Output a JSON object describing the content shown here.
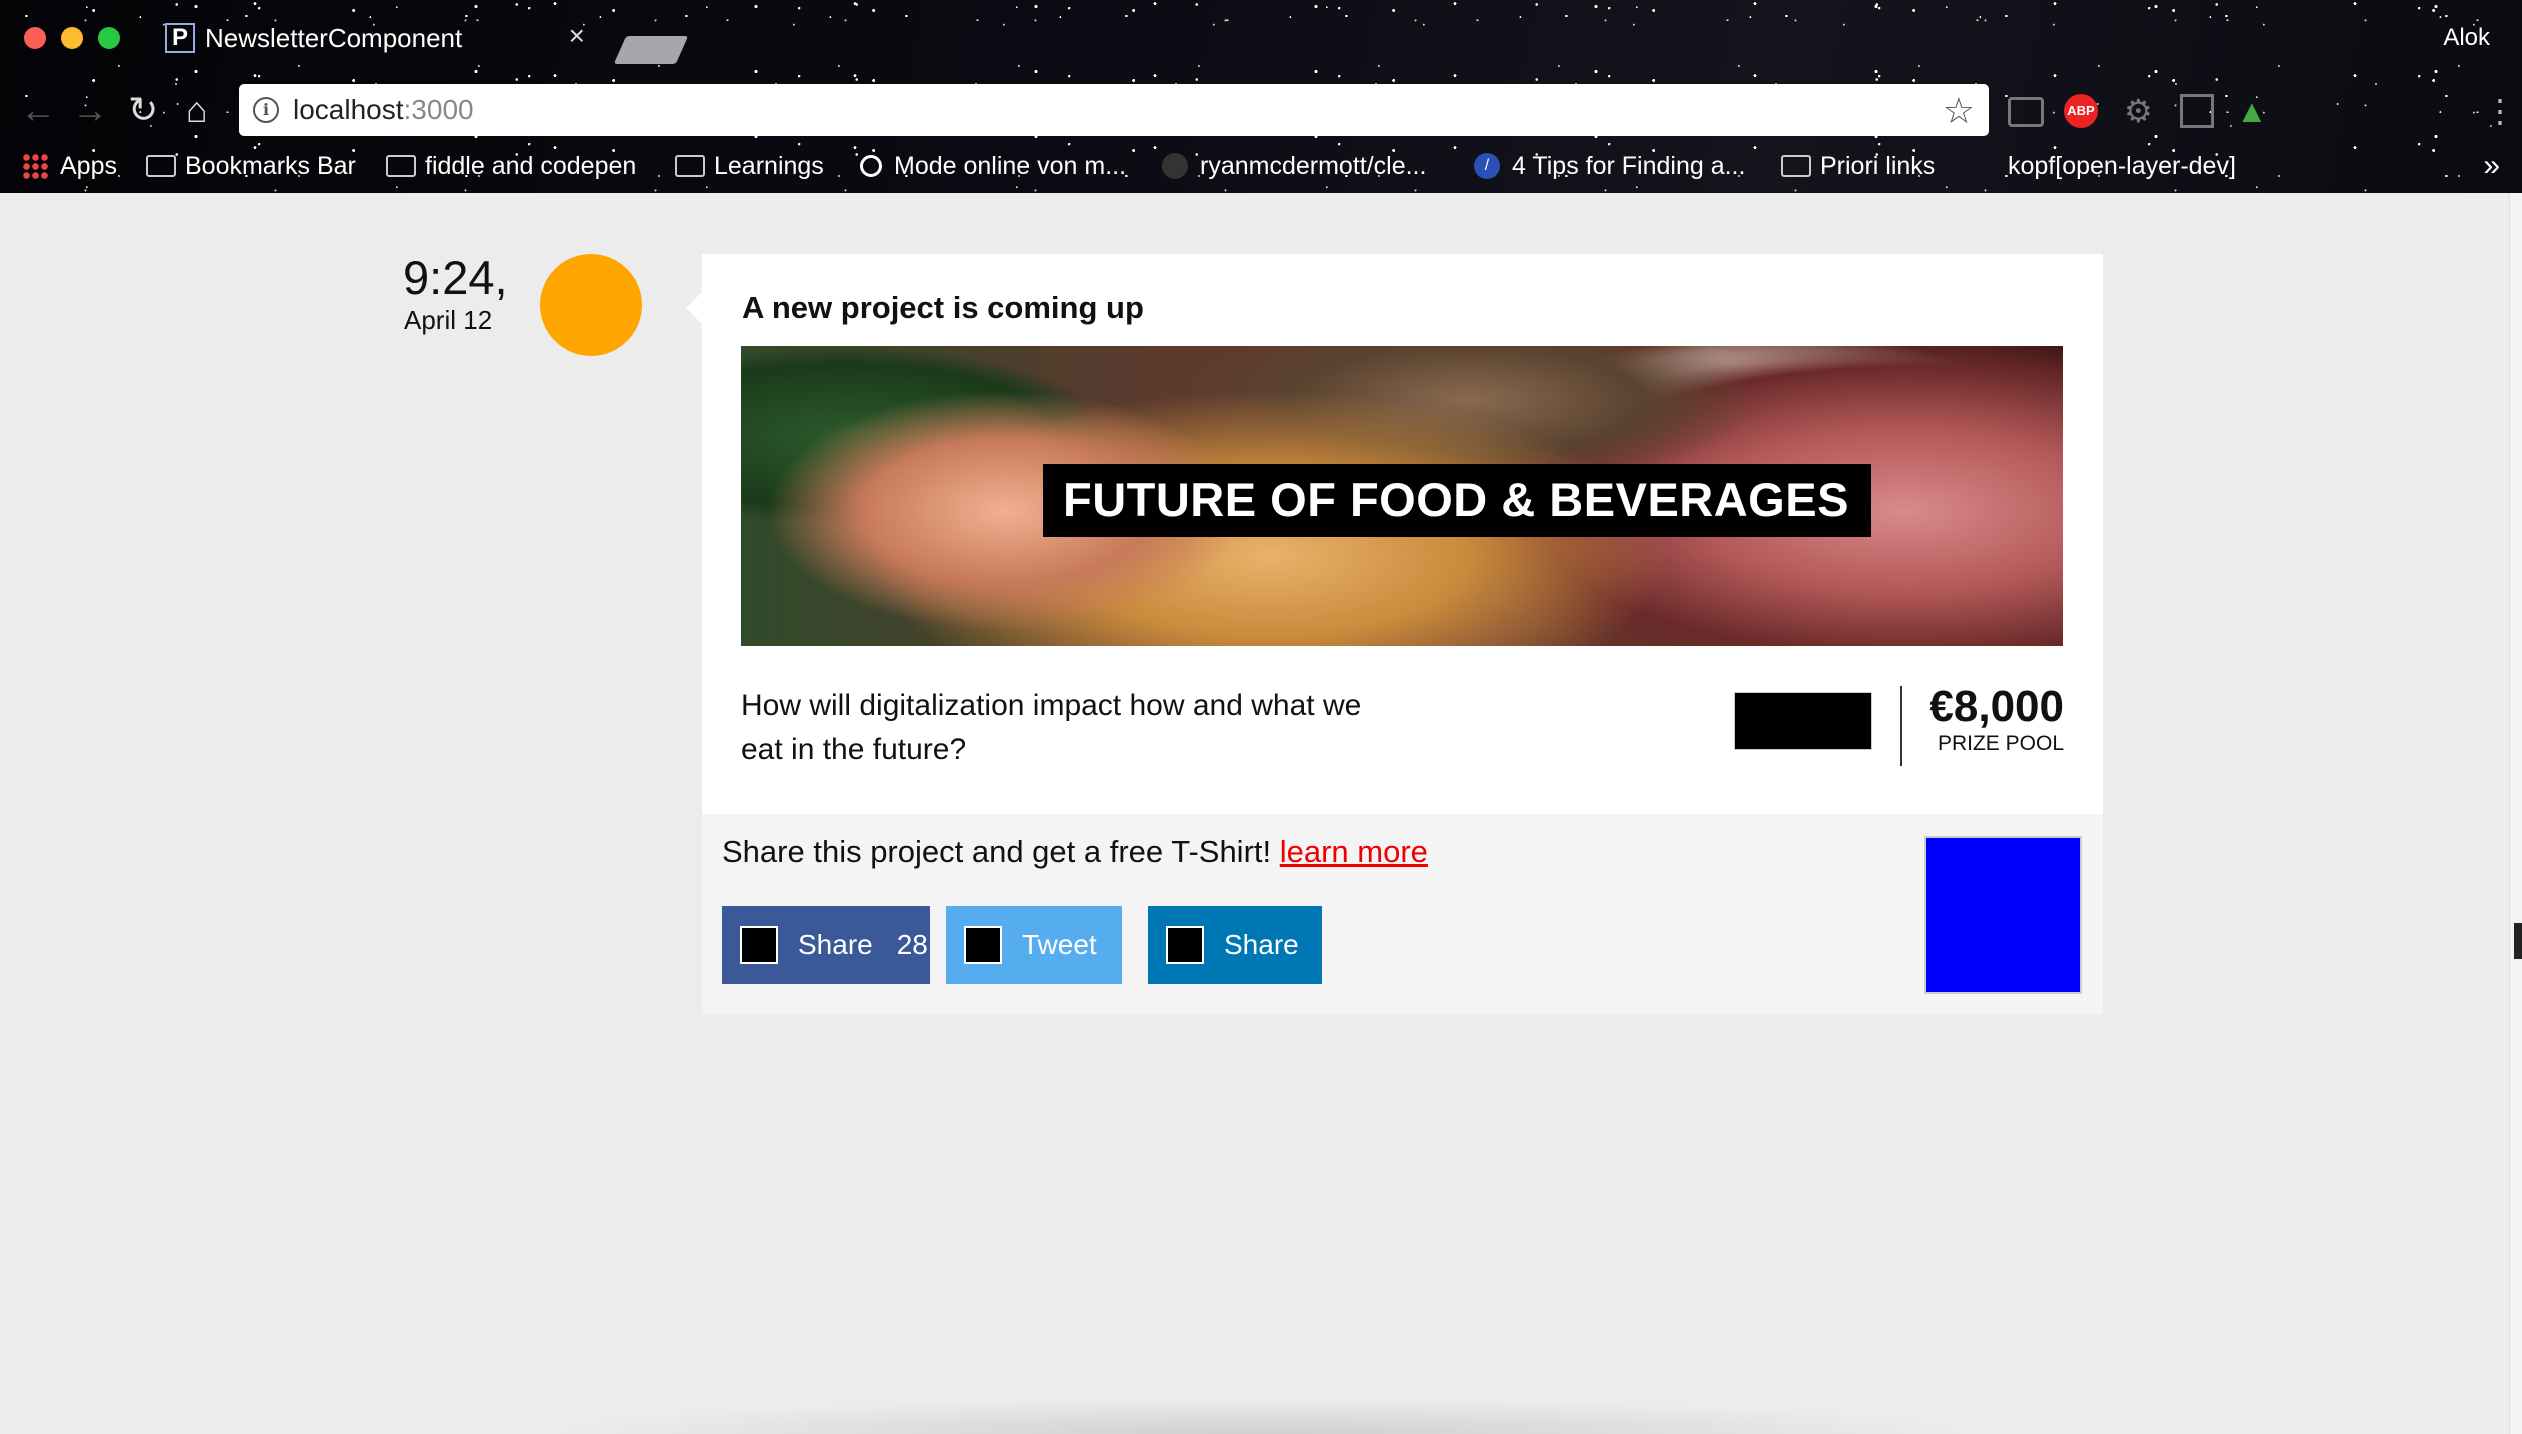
{
  "browser": {
    "tab_title": "NewsletterComponent",
    "tab_favicon_letter": "P",
    "tab_close": "×",
    "profile_name": "Alok",
    "url_host": "localhost",
    "url_port": ":3000",
    "bookmarks": [
      {
        "label": "Apps",
        "icon": "apps-icon"
      },
      {
        "label": "Bookmarks Bar",
        "icon": "folder-icon"
      },
      {
        "label": "fiddle and codepen",
        "icon": "folder-icon"
      },
      {
        "label": "Learnings",
        "icon": "folder-icon"
      },
      {
        "label": "Mode online von m...",
        "icon": "ring-icon"
      },
      {
        "label": "ryanmcdermott/cle...",
        "icon": "github-icon"
      },
      {
        "label": "4 Tips for Finding a...",
        "icon": "site-icon"
      },
      {
        "label": "Priori links",
        "icon": "folder-icon"
      },
      {
        "label": "kopf[open-layer-dev]",
        "icon": "none"
      }
    ],
    "bookmarks_overflow": "»"
  },
  "post": {
    "time": "9:24,",
    "date": "April 12",
    "avatar_color": "#ffa500",
    "title": "A new project is coming up",
    "hero_label": "FUTURE OF FOOD & BEVERAGES",
    "question": "How will digitalization impact how and what we eat in the future?",
    "prize_amount": "€8,000",
    "prize_label": "PRIZE POOL",
    "share_text": "Share this project and get a free T-Shirt! ",
    "learn_more": "learn more",
    "buttons": {
      "facebook_label": "Share",
      "facebook_count": "28",
      "twitter_label": "Tweet",
      "linkedin_label": "Share"
    },
    "colors": {
      "facebook": "#3b5998",
      "twitter": "#55acee",
      "linkedin": "#0077b5",
      "link": "#ee0000",
      "blue_square": "#0000ff"
    }
  }
}
